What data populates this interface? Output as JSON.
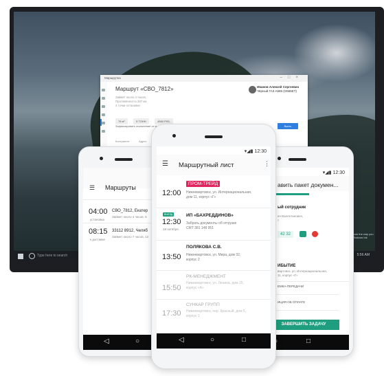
{
  "desktop": {
    "window_title": "Маршрутка",
    "route_title": "Маршрут «СВО_7812»",
    "route_sub": [
      "Займёт около 4 часов,",
      "Протяжённость 287 км,",
      "4 точки остановки"
    ],
    "user_name": "Иванов Алексей Сергеевич",
    "user_car": "Чёрный ГАЗ А665 (О565ЕТ)",
    "chips": [
      "76 м³",
      "5 ТОНН",
      "4980 РУБ."
    ],
    "note": "Зафиксировать отклонение от маршрута на 897 метр",
    "accept_btn": "Взять",
    "footer_left": "Контрагент",
    "footer_mid": "Адрес",
    "taskbar_search": "Type here to search",
    "tray_time": "5:56 AM",
    "notification": "Get things to look the way you like with the Windows Ink"
  },
  "phone_left": {
    "title": "Маршруты",
    "rows": [
      {
        "time": "04:00",
        "sub": "установка",
        "route": "СВО_7812, Екатер",
        "desc": "Займет около 4 часов, 6"
      },
      {
        "time": "08:15",
        "sub": "к доставке",
        "route": "33112 8912, Челяб",
        "desc": "Займет около 7 часов, 12"
      }
    ]
  },
  "phone_center": {
    "status_time": "12:30",
    "title": "Маршрутный лист",
    "items": [
      {
        "time": "12:00",
        "tag": "ПРОМ-ТРЕЙД",
        "address": [
          "Нижневартовск, ул. Интернациональная,",
          "дом 11, корпус «Г»"
        ]
      },
      {
        "time": "12:30",
        "badge": "ВЫЕЗД",
        "sub": "18 октября",
        "name": "ИП «БАХРЕДДИНОВ»",
        "address": [
          "Забрать документы об отгрузке",
          "СМТ 381 148 951"
        ]
      },
      {
        "time": "13:50",
        "name": "ПОЛЯКОВА С.В.",
        "address": [
          "Нижневартовск, ул. Мира, дом 32,",
          "корпус 2"
        ]
      },
      {
        "time": "15:50",
        "name": "РК-МЕНЕДЖМЕНТ",
        "address": [
          "Нижневартовск, ул. Ленина, дом 15,",
          "корпус «А»"
        ]
      },
      {
        "time": "17:30",
        "name": "СУНКАР ГРУПП",
        "address": [
          "Нижневартовск, пер. Красный, дом 5,",
          "корпус 1"
        ]
      }
    ]
  },
  "phone_right": {
    "status_time": "12:30",
    "title": "авить пакет докумен...",
    "section": "ый сотрудник",
    "person": [
      "ич Валентинович,",
      "т"
    ],
    "phone": "42 32",
    "arrival_label": "ИБЫТИЕ",
    "arrival_addr": [
      "вартовск, ул. Интернациональная,",
      "11, корпус «Г»"
    ],
    "field1": "ЕМКА-ПЕРЕДАЧИ",
    "field2": "ИЦИЯ ОБ ОПЛАТЕ",
    "finish": "ЗАВЕРШИТЬ ЗАДАЧУ"
  },
  "colors": {
    "accent_pink": "#e0245e",
    "accent_green": "#1e9e7e",
    "accent_blue": "#2f7fe0"
  }
}
